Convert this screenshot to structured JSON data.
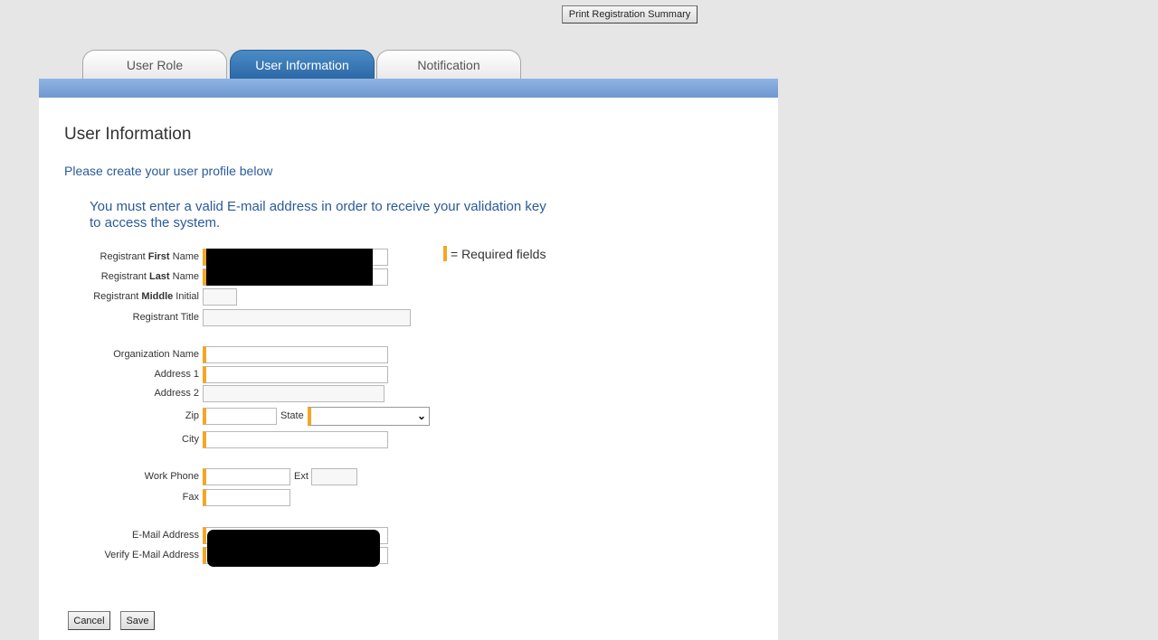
{
  "top": {
    "print_label": "Print Registration Summary"
  },
  "tabs": [
    {
      "label": "User Role",
      "active": false
    },
    {
      "label": "User Information",
      "active": true
    },
    {
      "label": "Notification",
      "active": false
    }
  ],
  "page": {
    "title": "User Information",
    "subtitle": "Please create your user profile below",
    "notice": "You must enter a valid E-mail address in order to receive your validation key to access the system.",
    "required_legend": "= Required fields"
  },
  "form": {
    "first_name": {
      "pre": "Registrant ",
      "bold": "First",
      "post": " Name",
      "value": ""
    },
    "last_name": {
      "pre": "Registrant ",
      "bold": "Last",
      "post": " Name",
      "value": ""
    },
    "middle_initial": {
      "pre": "Registrant ",
      "bold": "Middle",
      "post": " Initial",
      "value": ""
    },
    "title_label": "Registrant Title",
    "org_label": "Organization Name",
    "address1_label": "Address 1",
    "address2_label": "Address 2",
    "zip_label": "Zip",
    "state_label": "State",
    "state_value": "",
    "city_label": "City",
    "work_phone_label": "Work Phone",
    "ext_label": "Ext",
    "fax_label": "Fax",
    "email_label": "E-Mail Address",
    "verify_email_label": "Verify E-Mail Address"
  },
  "buttons": {
    "cancel": "Cancel",
    "save": "Save"
  },
  "colors": {
    "required_marker": "#f5a623",
    "accent_blue": "#2d68a6",
    "link_text": "#2a5a9a"
  }
}
